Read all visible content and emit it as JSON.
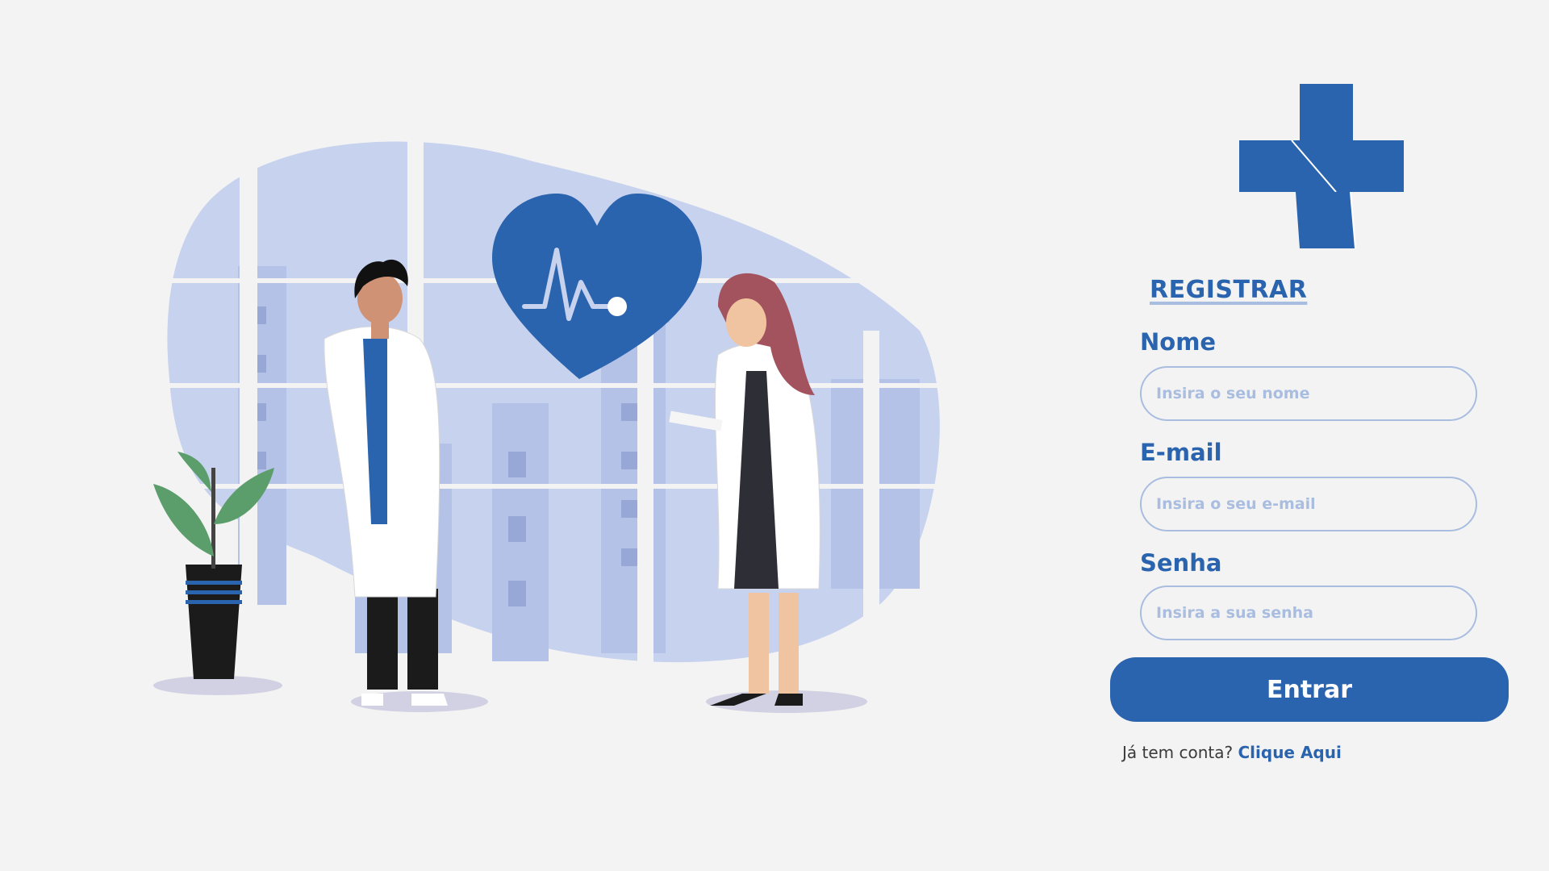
{
  "form": {
    "heading": "REGISTRAR",
    "name_label": "Nome",
    "name_placeholder": "Insira o seu nome",
    "email_label": "E-mail",
    "email_placeholder": "Insira o seu e-mail",
    "password_label": "Senha",
    "password_placeholder": "Insira a sua senha",
    "submit_label": "Entrar"
  },
  "footer": {
    "prompt": "Já tem conta?",
    "link_label": "Clique Aqui"
  },
  "icons": {
    "logo": "medical-cross-icon",
    "illustration": "doctors-heartbeat-illustration"
  },
  "colors": {
    "primary": "#2a63ae",
    "border": "#a9bde0",
    "background": "#f3f3f3",
    "illustration_light": "#c7d2ee"
  }
}
